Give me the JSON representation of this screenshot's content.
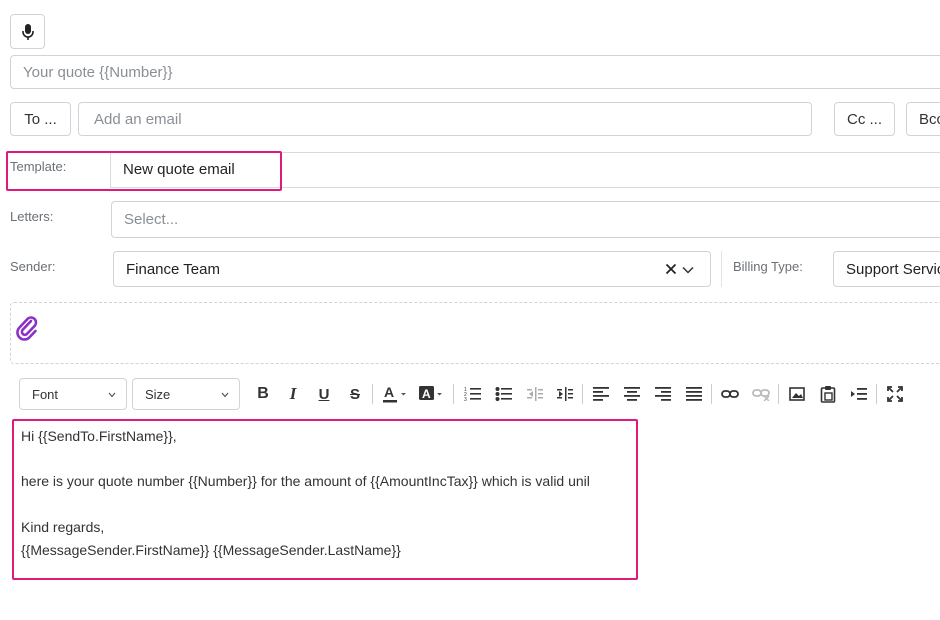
{
  "subject": {
    "placeholder": "Your quote {{Number}}"
  },
  "recipients": {
    "to_label": "To ...",
    "email_placeholder": "Add an email",
    "cc_label": "Cc ...",
    "bcc_label": "Bcc"
  },
  "template": {
    "label": "Template:",
    "value": "New quote email"
  },
  "letters": {
    "label": "Letters:",
    "placeholder": "Select..."
  },
  "sender": {
    "label": "Sender:",
    "value": "Finance Team"
  },
  "billing": {
    "label": "Billing Type:",
    "value": "Support Services"
  },
  "toolbar": {
    "font_label": "Font",
    "size_label": "Size",
    "icons": [
      "bold-icon",
      "italic-icon",
      "underline-icon",
      "strikethrough-icon",
      "font-color-icon",
      "background-color-icon",
      "ordered-list-icon",
      "unordered-list-icon",
      "outdent-icon",
      "indent-icon",
      "align-left-icon",
      "align-center-icon",
      "align-right-icon",
      "justify-icon",
      "link-icon",
      "unlink-icon",
      "image-icon",
      "paste-icon",
      "insert-icon",
      "fullscreen-icon"
    ]
  },
  "editor": {
    "line1": "Hi {{SendTo.FirstName}},",
    "line2": "here is your quote number {{Number}} for the amount of {{AmountIncTax}} which is valid unil",
    "line3": "Kind regards,",
    "line4": "{{MessageSender.FirstName}} {{MessageSender.LastName}}"
  },
  "colors": {
    "highlight": "#e0197d",
    "attachment": "#8b2fc9"
  }
}
